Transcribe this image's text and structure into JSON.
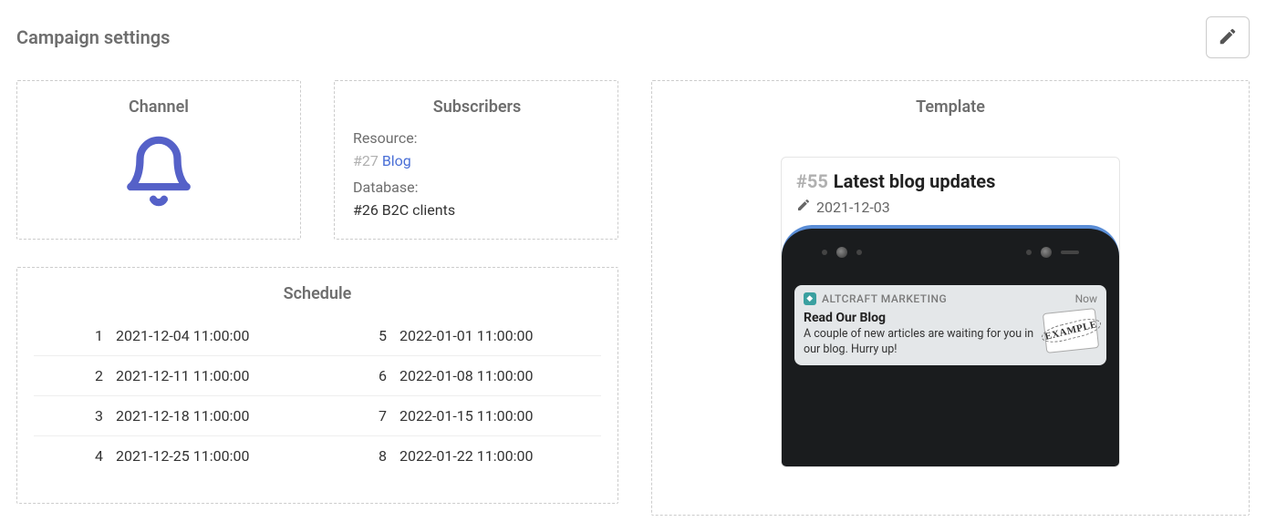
{
  "page": {
    "title": "Campaign settings"
  },
  "channel": {
    "title": "Channel"
  },
  "subscribers": {
    "title": "Subscribers",
    "resource_label": "Resource:",
    "resource_id": "#27",
    "resource_name": "Blog",
    "database_label": "Database:",
    "database_value": "#26 B2C clients"
  },
  "schedule": {
    "title": "Schedule",
    "left": [
      {
        "n": "1",
        "dt": "2021-12-04 11:00:00"
      },
      {
        "n": "2",
        "dt": "2021-12-11 11:00:00"
      },
      {
        "n": "3",
        "dt": "2021-12-18 11:00:00"
      },
      {
        "n": "4",
        "dt": "2021-12-25 11:00:00"
      }
    ],
    "right": [
      {
        "n": "5",
        "dt": "2022-01-01 11:00:00"
      },
      {
        "n": "6",
        "dt": "2022-01-08 11:00:00"
      },
      {
        "n": "7",
        "dt": "2022-01-15 11:00:00"
      },
      {
        "n": "8",
        "dt": "2022-01-22 11:00:00"
      }
    ]
  },
  "template": {
    "title": "Template",
    "id": "#55",
    "name": "Latest blog updates",
    "date": "2021-12-03",
    "preview": {
      "app": "ALTCRAFT MARKETING",
      "time": "Now",
      "title": "Read Our Blog",
      "message": "A couple of new articles are waiting for you in our blog. Hurry up!",
      "stamp": "EXAMPLE"
    }
  }
}
